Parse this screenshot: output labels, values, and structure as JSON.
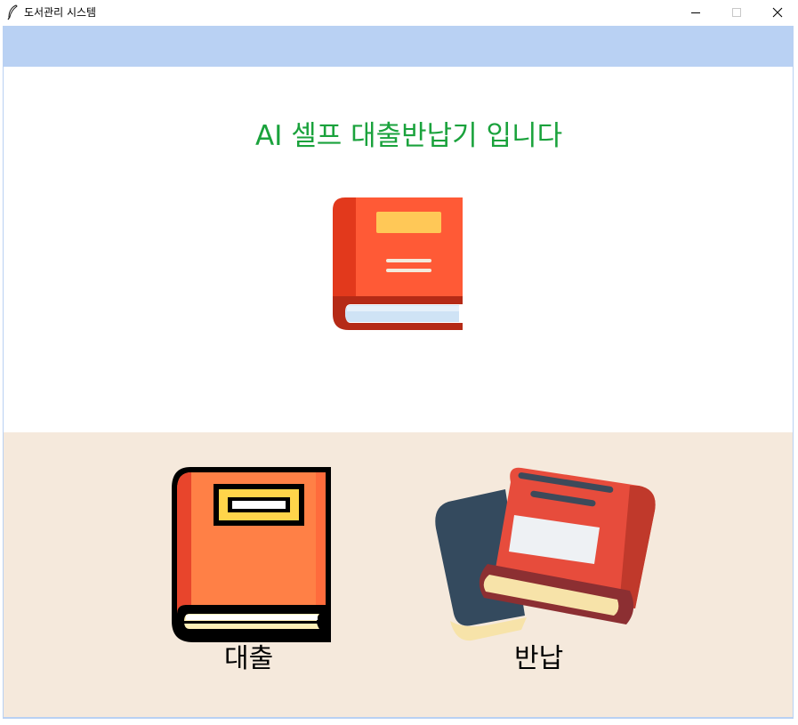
{
  "window": {
    "title": "도서관리 시스템",
    "app_icon": "feather-icon",
    "controls": [
      "minimize-icon",
      "maximize-icon",
      "close-icon"
    ]
  },
  "main": {
    "headline": "AI 셀프 대출반납기 입니다",
    "hero_icon": "red-book-icon"
  },
  "actions": {
    "loan_label": "대출",
    "loan_icon": "closed-book-icon",
    "return_label": "반납",
    "return_icon": "stacked-books-icon"
  },
  "colors": {
    "top_band": "#b9d1f3",
    "headline": "#1aa23c",
    "bottom_panel": "#f5e9dc"
  }
}
